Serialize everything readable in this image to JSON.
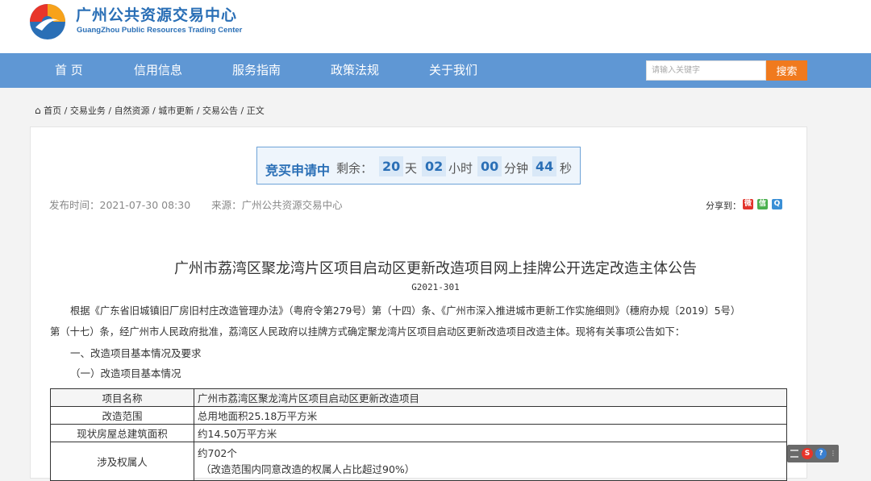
{
  "header": {
    "title": "广州公共资源交易中心",
    "subtitle": "GuangZhou Public Resources Trading Center"
  },
  "nav": {
    "items": [
      "首 页",
      "信用信息",
      "服务指南",
      "政策法规",
      "关于我们"
    ]
  },
  "search": {
    "placeholder": "请输入关键字",
    "button_label": "搜索"
  },
  "breadcrumb": {
    "items": [
      "首页",
      "交易业务",
      "自然资源",
      "城市更新",
      "交易公告",
      "正文"
    ],
    "separator": "/"
  },
  "countdown": {
    "label": "竞买申请中",
    "remaining_label": "剩余：",
    "days": "20",
    "days_unit": "天",
    "hours": "02",
    "hours_unit": "小时",
    "minutes": "00",
    "minutes_unit": "分钟",
    "seconds": "44",
    "seconds_unit": "秒"
  },
  "meta": {
    "publish_time": "发布时间：2021-07-30 08:30",
    "source": "来源：广州公共资源交易中心"
  },
  "share": {
    "label": "分享到：",
    "icons": [
      "weibo-icon",
      "wechat-icon",
      "qq-icon"
    ]
  },
  "article": {
    "title": "广州市荔湾区聚龙湾片区项目启动区更新改造项目网上挂牌公开选定改造主体公告",
    "doc_number": "G2021-301",
    "para1_line1": "根据《广东省旧城镇旧厂房旧村庄改造管理办法》（粤府令第279号）第（十四）条、《广州市深入推进城市更新工作实施细则》（穗府办规〔2019〕5号）",
    "para1_line2": "第（十七）条，经广州市人民政府批准，荔湾区人民政府以挂牌方式确定聚龙湾片区项目启动区更新改造项目改造主体。现将有关事项公告如下：",
    "section1": "一、改造项目基本情况及要求",
    "section1_1": "（一）改造项目基本情况"
  },
  "table": {
    "rows": [
      {
        "key": "项目名称",
        "value": "广州市荔湾区聚龙湾片区项目启动区更新改造项目"
      },
      {
        "key": "改造范围",
        "value": "总用地面积25.18万平方米"
      },
      {
        "key": "现状房屋总建筑面积",
        "value": "约14.50万平方米"
      },
      {
        "key": "涉及权属人",
        "value": "约702个",
        "value2": "（改造范围内同意改造的权属人占比超过90%）"
      }
    ]
  },
  "colors": {
    "nav_bg": "#5f97d4",
    "brand": "#2a6fb6",
    "search_button": "#f07a1e"
  }
}
